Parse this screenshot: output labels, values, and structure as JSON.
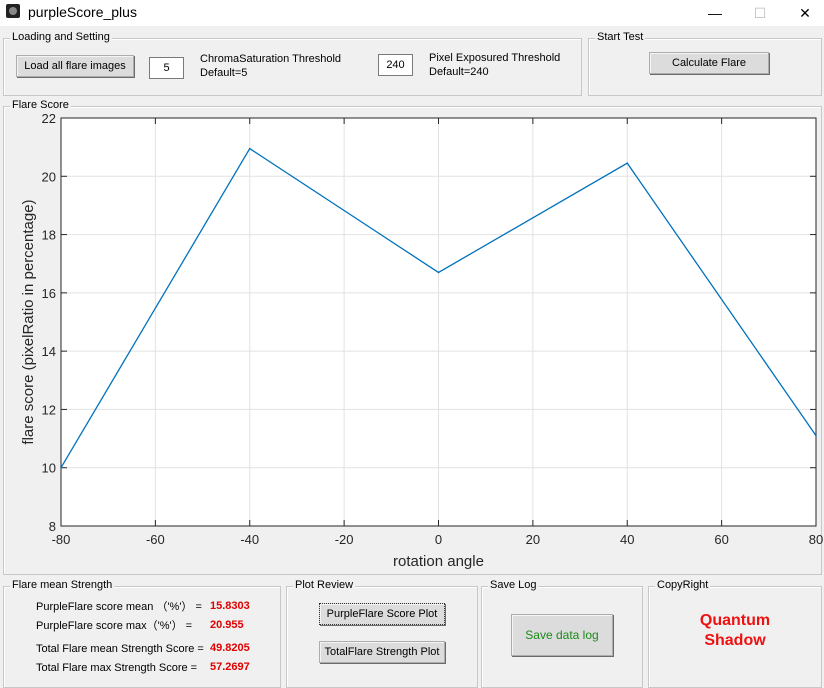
{
  "window": {
    "title": "purpleScore_plus",
    "minimize": "—",
    "maximize": "☐",
    "close": "✕"
  },
  "loading": {
    "title": "Loading and Setting",
    "load_button": "Load all flare images",
    "chroma_value": "5",
    "chroma_label": "ChromaSaturation Threshold",
    "chroma_default": "Default=5",
    "pixel_value": "240",
    "pixel_label": "Pixel Exposured Threshold",
    "pixel_default": "Default=240"
  },
  "start_test": {
    "title": "Start Test",
    "calc_button": "Calculate Flare"
  },
  "flare_score": {
    "title": "Flare Score"
  },
  "chart_data": {
    "type": "line",
    "x": [
      -80,
      -40,
      0,
      40,
      80
    ],
    "y": [
      10.0,
      20.95,
      16.7,
      20.45,
      11.1
    ],
    "xlabel": "rotation angle",
    "ylabel": "flare score (pixelRatio in percentage)",
    "xlim": [
      -80,
      80
    ],
    "ylim": [
      8,
      22
    ],
    "xticks": [
      -80,
      -60,
      -40,
      -20,
      0,
      20,
      40,
      60,
      80
    ],
    "yticks": [
      8,
      10,
      12,
      14,
      16,
      18,
      20,
      22
    ],
    "grid": true,
    "line_color": "#0072bd"
  },
  "mean_strength": {
    "title": "Flare mean Strength",
    "rows": [
      {
        "label": "PurpleFlare score mean （'%'）  =",
        "value": "15.8303"
      },
      {
        "label": "PurpleFlare score max（'%'）  =",
        "value": "20.955"
      },
      {
        "label": "Total Flare mean Strength Score =",
        "value": "49.8205"
      },
      {
        "label": "Total Flare max Strength Score  =",
        "value": "57.2697"
      }
    ]
  },
  "plot_review": {
    "title": "Plot Review",
    "purple_button": "PurpleFlare Score Plot",
    "total_button": "TotalFlare Strength Plot"
  },
  "save_log": {
    "title": "Save Log",
    "save_button": "Save data log"
  },
  "copyright": {
    "title": "CopyRight",
    "line1": "Quantum",
    "line2": "Shadow"
  }
}
